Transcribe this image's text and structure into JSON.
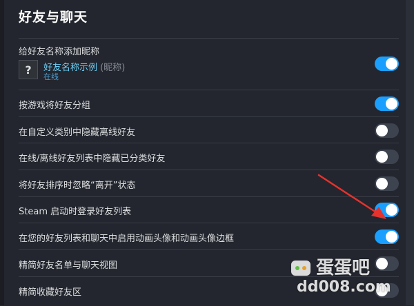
{
  "section": {
    "title": "好友与聊天"
  },
  "nickname_setting": {
    "label": "给好友名称添加昵称",
    "toggle_on": true,
    "preview": {
      "avatar_glyph": "?",
      "name": "好友名称示例",
      "nickname": " (昵称)",
      "status": "在线"
    }
  },
  "settings": [
    {
      "label": "按游戏将好友分组",
      "toggle_on": true
    },
    {
      "label": "在自定义类别中隐藏离线好友",
      "toggle_on": false
    },
    {
      "label": "在线/离线好友列表中隐藏已分类好友",
      "toggle_on": false
    },
    {
      "label": "将好友排序时忽略“离开”状态",
      "toggle_on": false
    },
    {
      "label": "Steam 启动时登录好友列表",
      "toggle_on": true
    },
    {
      "label": "在您的好友列表和聊天中启用动画头像和动画头像边框",
      "toggle_on": true
    },
    {
      "label": "精简好友名单与聊天视图",
      "toggle_on": false
    },
    {
      "label": "精简收藏好友区",
      "toggle_on": false
    }
  ],
  "watermark": {
    "brand": "蛋蛋吧",
    "site": "dd008.com"
  },
  "colors": {
    "accent": "#1a9fff",
    "background": "#23262e",
    "arrow": "#e5322d"
  }
}
